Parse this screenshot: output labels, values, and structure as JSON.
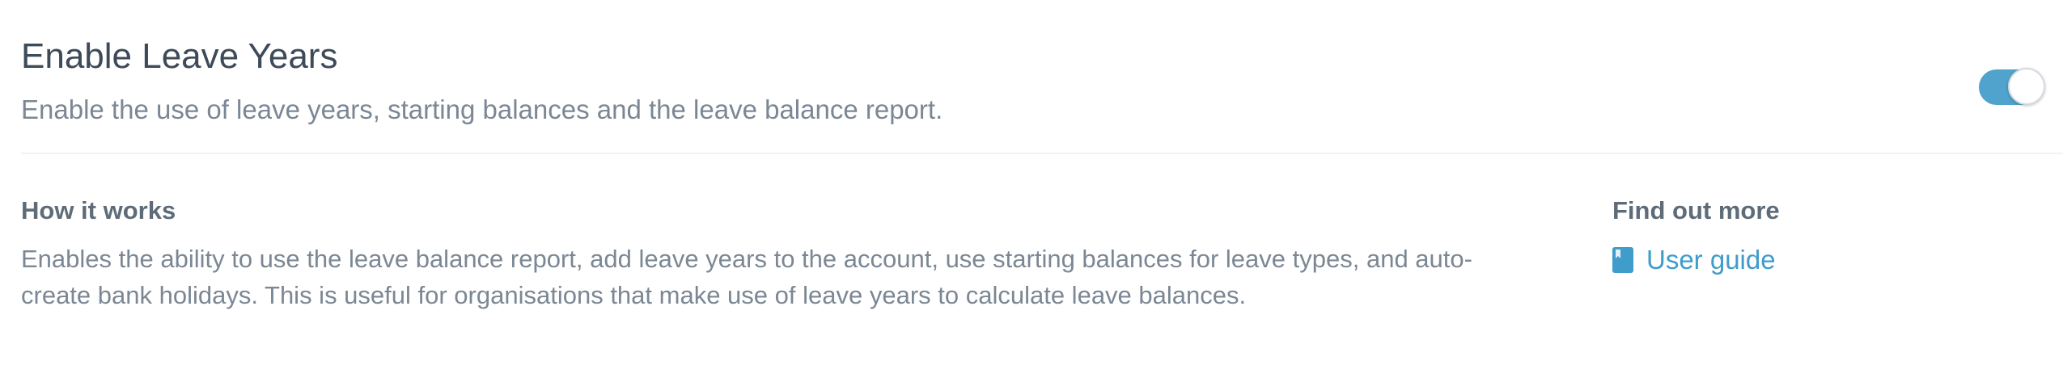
{
  "setting": {
    "title": "Enable Leave Years",
    "description": "Enable the use of leave years, starting balances and the leave balance report.",
    "toggle_enabled": true
  },
  "how_it_works": {
    "heading": "How it works",
    "body": "Enables the ability to use the leave balance report, add leave years to the account, use starting balances for leave types, and auto-create bank holidays. This is useful for organisations that make use of leave years to calculate leave balances."
  },
  "find_out_more": {
    "heading": "Find out more",
    "link_label": "User guide",
    "link_icon": "book-icon"
  },
  "colors": {
    "accent": "#4fa3cc",
    "link": "#3f9ccb",
    "title_text": "#3d4a58",
    "muted_text": "#7b8794"
  }
}
